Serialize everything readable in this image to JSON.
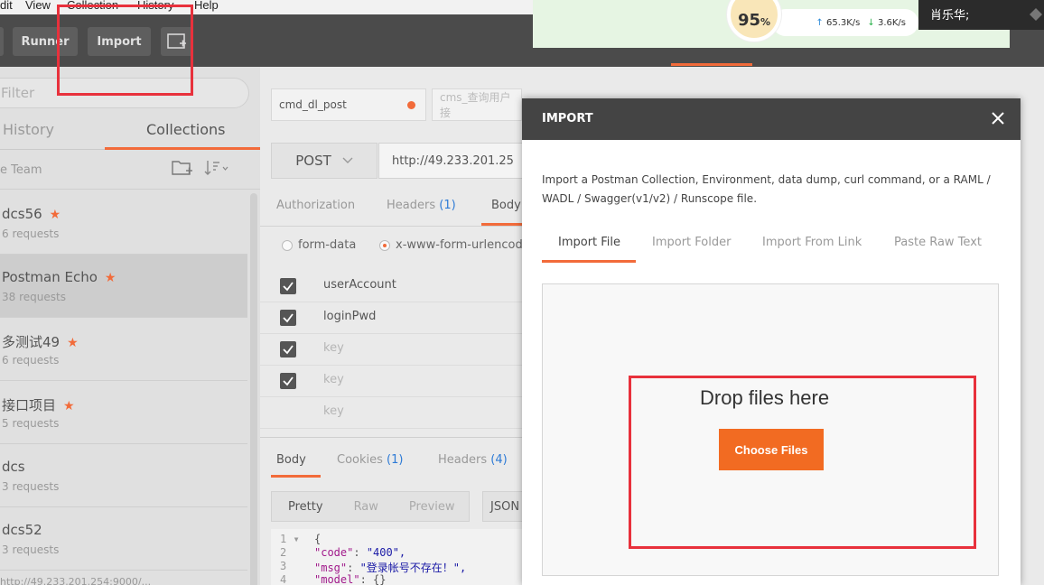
{
  "menubar": {
    "items": [
      "dit",
      "View",
      "Collection",
      "History",
      "Help"
    ]
  },
  "toolbar": {
    "runner_label": "Runner",
    "import_label": "Import"
  },
  "notification": {
    "percent": "95",
    "percent_unit": "%",
    "upload_speed": "65.3K/s",
    "download_speed": "3.6K/s",
    "user_name": "肖乐华;"
  },
  "sidebar": {
    "filter_placeholder": "Filter",
    "tabs": [
      "History",
      "Collections"
    ],
    "team_label": "e  Team",
    "collections": [
      {
        "name": "dcs56",
        "requests": "6 requests",
        "starred": true
      },
      {
        "name": "Postman Echo",
        "requests": "38 requests",
        "starred": true
      },
      {
        "name": "多测试49",
        "requests": "6 requests",
        "starred": true
      },
      {
        "name": "接口项目",
        "requests": "5 requests",
        "starred": true
      },
      {
        "name": "dcs",
        "requests": "3 requests",
        "starred": false
      },
      {
        "name": "dcs52",
        "requests": "3 requests",
        "starred": false
      }
    ],
    "bottom_text": "http://49.233.201.254:9000/..."
  },
  "request": {
    "tab_active": "cmd_dl_post",
    "tab_second": "cms_查询用户接",
    "method": "POST",
    "url": "http://49.233.201.25",
    "subtabs": {
      "authorization": "Authorization",
      "headers": "Headers",
      "headers_count": "(1)",
      "body": "Body"
    },
    "body_types": {
      "form_data": "form-data",
      "urlencoded": "x-www-form-urlencoded"
    },
    "params": [
      "userAccount",
      "loginPwd",
      "key",
      "key",
      "key"
    ]
  },
  "response": {
    "tabs": {
      "body": "Body",
      "cookies": "Cookies",
      "cookies_count": "(1)",
      "headers": "Headers",
      "headers_count": "(4)"
    },
    "formats": [
      "Pretty",
      "Raw",
      "Preview"
    ],
    "lang": "JSON",
    "code_lines": [
      {
        "num": "1 ▾",
        "text": "{"
      },
      {
        "num": "2",
        "key": "\"code\"",
        "value": "\"400\","
      },
      {
        "num": "3",
        "key": "\"msg\"",
        "value": "\"登录帐号不存在！\","
      },
      {
        "num": "4",
        "key": "\"model\"",
        "value": "{}"
      }
    ]
  },
  "modal": {
    "title": "IMPORT",
    "description": "Import a Postman Collection, Environment, data dump, curl command, or a RAML / WADL / Swagger(v1/v2) / Runscope file.",
    "tabs": [
      "Import File",
      "Import Folder",
      "Import From Link",
      "Paste Raw Text"
    ],
    "drop_text": "Drop files here",
    "choose_button": "Choose Files"
  },
  "colors": {
    "accent": "#f26b3a",
    "highlight": "#e8313c",
    "header_dark": "#444444"
  }
}
